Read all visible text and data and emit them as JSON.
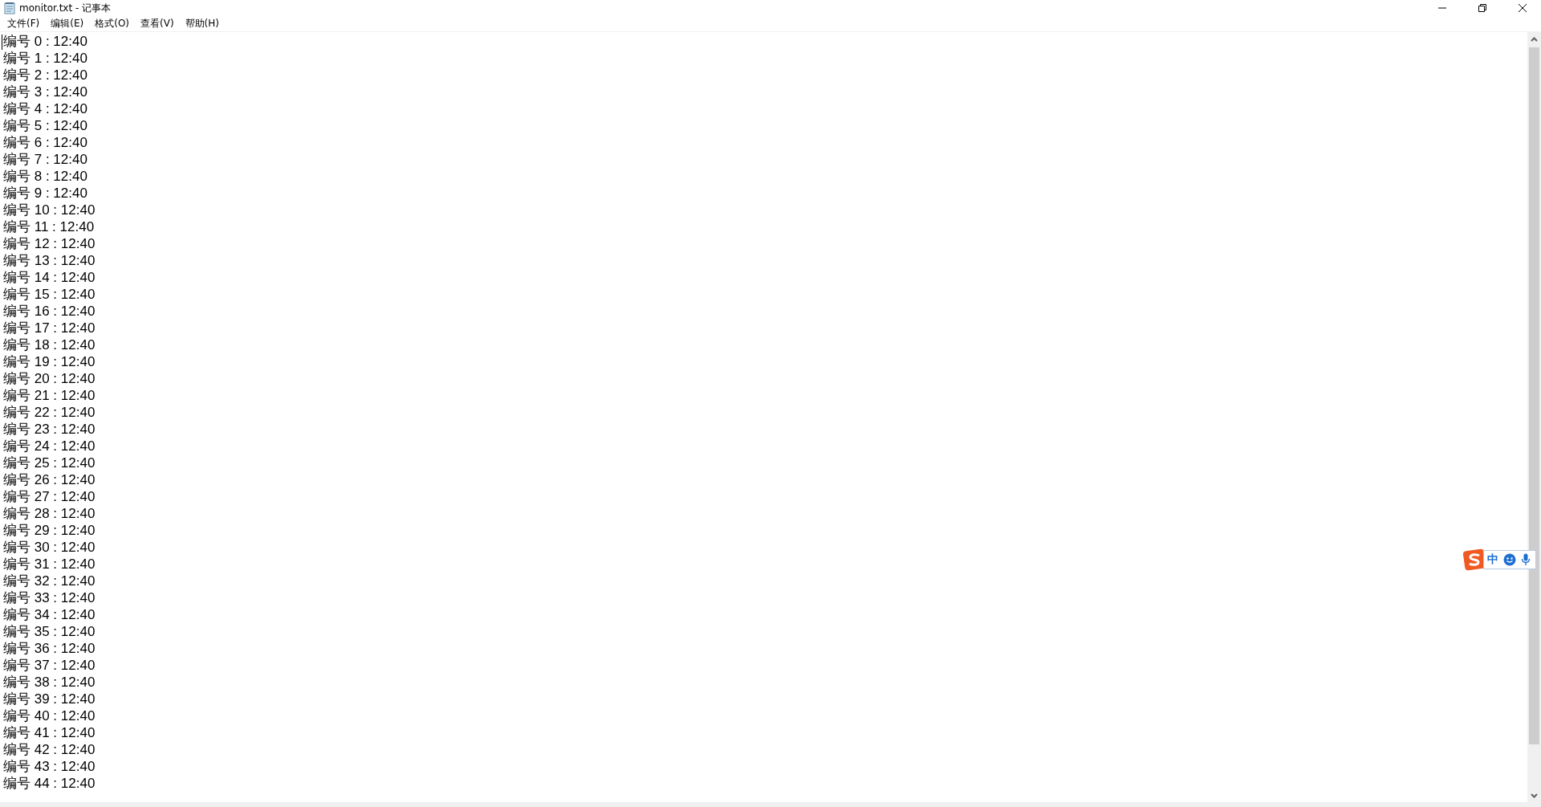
{
  "window": {
    "title": "monitor.txt - 记事本"
  },
  "menu": [
    "文件(F)",
    "编辑(E)",
    "格式(O)",
    "查看(V)",
    "帮助(H)"
  ],
  "editor": {
    "lines": [
      "编号 0 : 12:40",
      "编号 1 : 12:40",
      "编号 2 : 12:40",
      "编号 3 : 12:40",
      "编号 4 : 12:40",
      "编号 5 : 12:40",
      "编号 6 : 12:40",
      "编号 7 : 12:40",
      "编号 8 : 12:40",
      "编号 9 : 12:40",
      "编号 10 : 12:40",
      "编号 11 : 12:40",
      "编号 12 : 12:40",
      "编号 13 : 12:40",
      "编号 14 : 12:40",
      "编号 15 : 12:40",
      "编号 16 : 12:40",
      "编号 17 : 12:40",
      "编号 18 : 12:40",
      "编号 19 : 12:40",
      "编号 20 : 12:40",
      "编号 21 : 12:40",
      "编号 22 : 12:40",
      "编号 23 : 12:40",
      "编号 24 : 12:40",
      "编号 25 : 12:40",
      "编号 26 : 12:40",
      "编号 27 : 12:40",
      "编号 28 : 12:40",
      "编号 29 : 12:40",
      "编号 30 : 12:40",
      "编号 31 : 12:40",
      "编号 32 : 12:40",
      "编号 33 : 12:40",
      "编号 34 : 12:40",
      "编号 35 : 12:40",
      "编号 36 : 12:40",
      "编号 37 : 12:40",
      "编号 38 : 12:40",
      "编号 39 : 12:40",
      "编号 40 : 12:40",
      "编号 41 : 12:40",
      "编号 42 : 12:40",
      "编号 43 : 12:40",
      "编号 44 : 12:40"
    ]
  },
  "ime": {
    "mode": "中"
  }
}
